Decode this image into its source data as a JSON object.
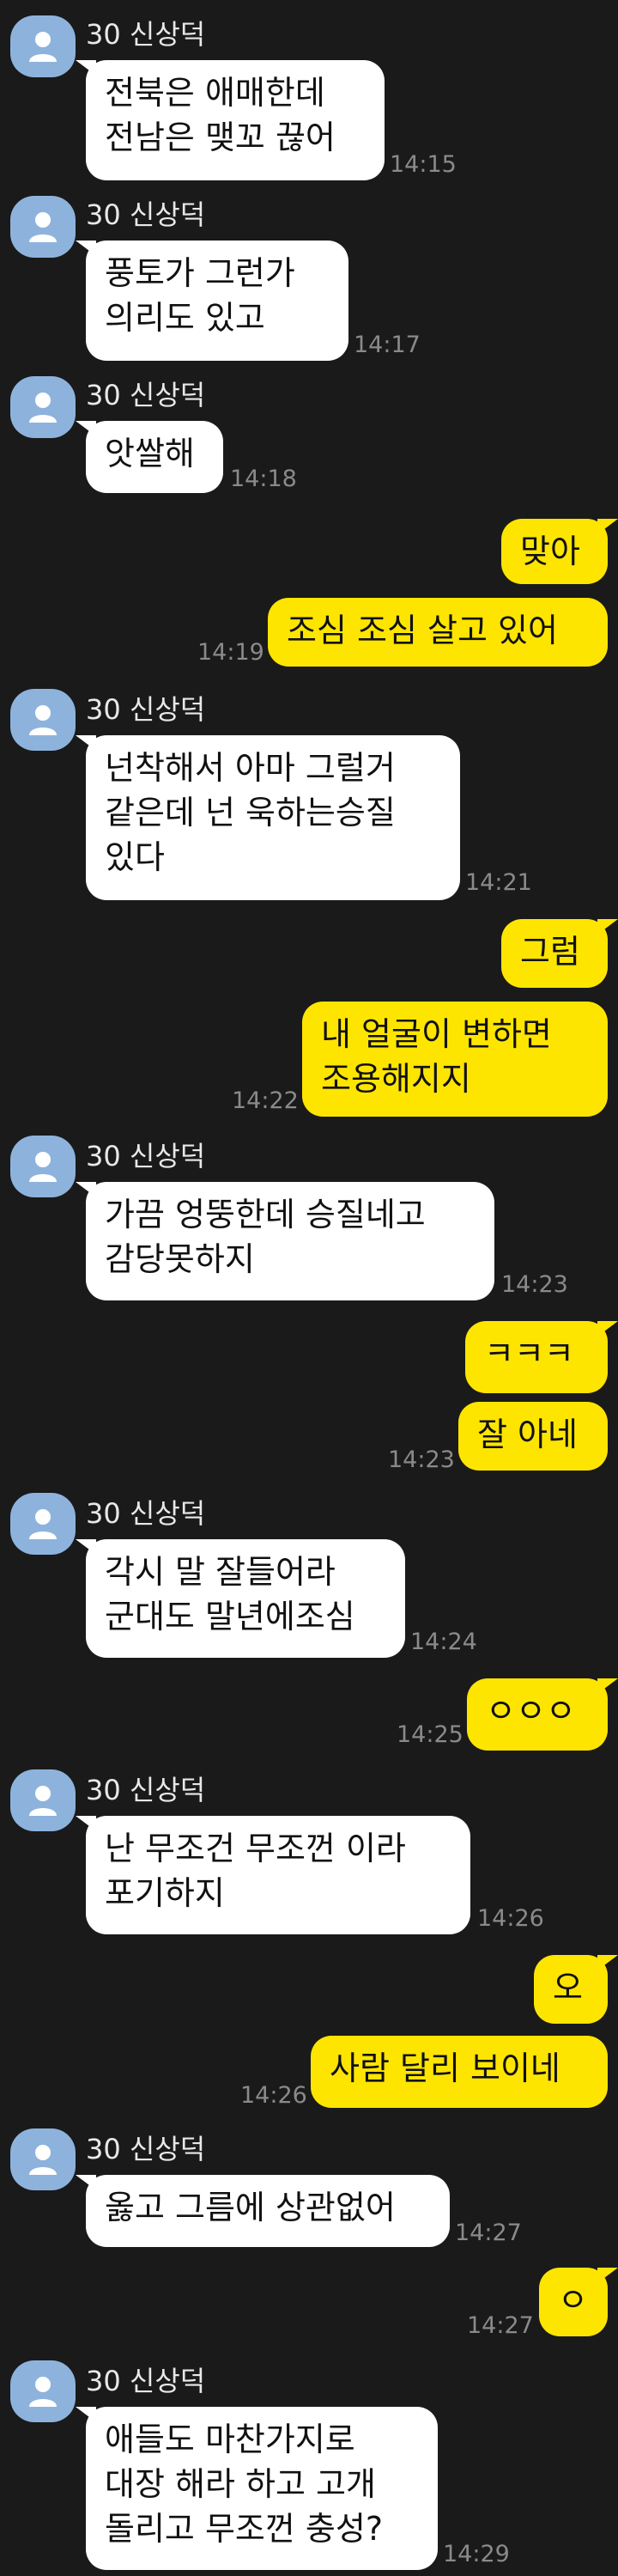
{
  "sender_name": "30 신상덕",
  "messages": [
    {
      "id": "m1",
      "from": "recv",
      "text": "전북은 애매한데\n전남은 맺꼬 끊어",
      "time": "14:15"
    },
    {
      "id": "m2",
      "from": "recv",
      "text": "풍토가 그런가\n의리도 있고",
      "time": "14:17"
    },
    {
      "id": "m3",
      "from": "recv",
      "text": "앗쌀해",
      "time": "14:18"
    },
    {
      "id": "m4",
      "from": "sent",
      "text": "맞아",
      "time": ""
    },
    {
      "id": "m5",
      "from": "sent",
      "text": "조심 조심 살고 있어",
      "time": "14:19"
    },
    {
      "id": "m6",
      "from": "recv",
      "text": "넌착해서 아마 그럴거\n같은데 넌 욱하는승질\n있다",
      "time": "14:21"
    },
    {
      "id": "m7",
      "from": "sent",
      "text": "그럼",
      "time": ""
    },
    {
      "id": "m8",
      "from": "sent",
      "text": "내 얼굴이 변하면\n조용해지지",
      "time": "14:22"
    },
    {
      "id": "m9",
      "from": "recv",
      "text": "가끔 엉뚱한데 승질네고\n감당못하지",
      "time": "14:23"
    },
    {
      "id": "m10",
      "from": "sent",
      "text": "ㅋㅋㅋ",
      "time": ""
    },
    {
      "id": "m11",
      "from": "sent",
      "text": "잘 아네",
      "time": "14:23"
    },
    {
      "id": "m12",
      "from": "recv",
      "text": "각시 말 잘들어라\n군대도 말년에조심",
      "time": "14:24"
    },
    {
      "id": "m13",
      "from": "sent",
      "text": "ㅇㅇㅇ",
      "time": "14:25"
    },
    {
      "id": "m14",
      "from": "recv",
      "text": "난 무조건 무조껀 이라\n포기하지",
      "time": "14:26"
    },
    {
      "id": "m15",
      "from": "sent",
      "text": "오",
      "time": ""
    },
    {
      "id": "m16",
      "from": "sent",
      "text": "사람 달리 보이네",
      "time": "14:26"
    },
    {
      "id": "m17",
      "from": "recv",
      "text": "옳고 그름에 상관없어",
      "time": "14:27"
    },
    {
      "id": "m18",
      "from": "sent",
      "text": "ㅇ",
      "time": "14:27"
    },
    {
      "id": "m19",
      "from": "recv",
      "text": "애들도 마찬가지로\n대장 해라 하고 고개\n돌리고 무조껀 충성?",
      "time": "14:29"
    }
  ],
  "colors": {
    "background": "#1a1a1a",
    "received_bubble": "#ffffff",
    "sent_bubble": "#fee500",
    "avatar": "#8db3dd",
    "timestamp": "#8a8a8a"
  },
  "icons": {
    "avatar": "person-silhouette-icon"
  }
}
